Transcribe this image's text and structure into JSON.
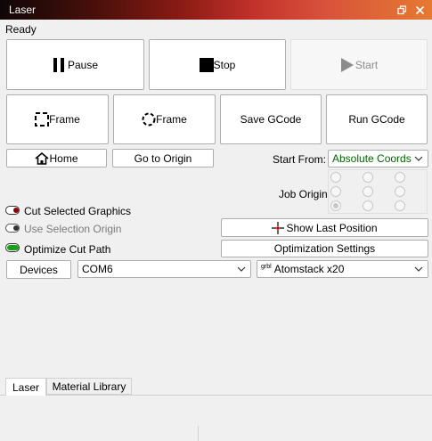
{
  "window": {
    "title": "Laser"
  },
  "status": "Ready",
  "buttons": {
    "pause": "Pause",
    "stop": "Stop",
    "start": "Start",
    "frame_rect": "Frame",
    "frame_circle": "Frame",
    "save_gcode": "Save GCode",
    "run_gcode": "Run GCode",
    "home": "Home",
    "go_to_origin": "Go to Origin",
    "show_last_position": "Show Last Position",
    "optimization_settings": "Optimization Settings",
    "devices": "Devices"
  },
  "start_from": {
    "label": "Start From:",
    "value": "Absolute Coords"
  },
  "job_origin": {
    "label": "Job Origin",
    "selected_row": 2,
    "selected_col": 0
  },
  "toggles": {
    "cut_selected_graphics": {
      "label": "Cut Selected Graphics",
      "on": false,
      "color": "#8b0000"
    },
    "use_selection_origin": {
      "label": "Use Selection Origin",
      "on": false,
      "disabled": true
    },
    "optimize_cut_path": {
      "label": "Optimize Cut Path",
      "on": true,
      "color": "#1aa01a"
    }
  },
  "port": {
    "value": "COM6"
  },
  "device": {
    "prefix": "grbl",
    "value": "Atomstack x20"
  },
  "tabs": [
    {
      "label": "Laser",
      "active": true
    },
    {
      "label": "Material Library",
      "active": false
    }
  ]
}
